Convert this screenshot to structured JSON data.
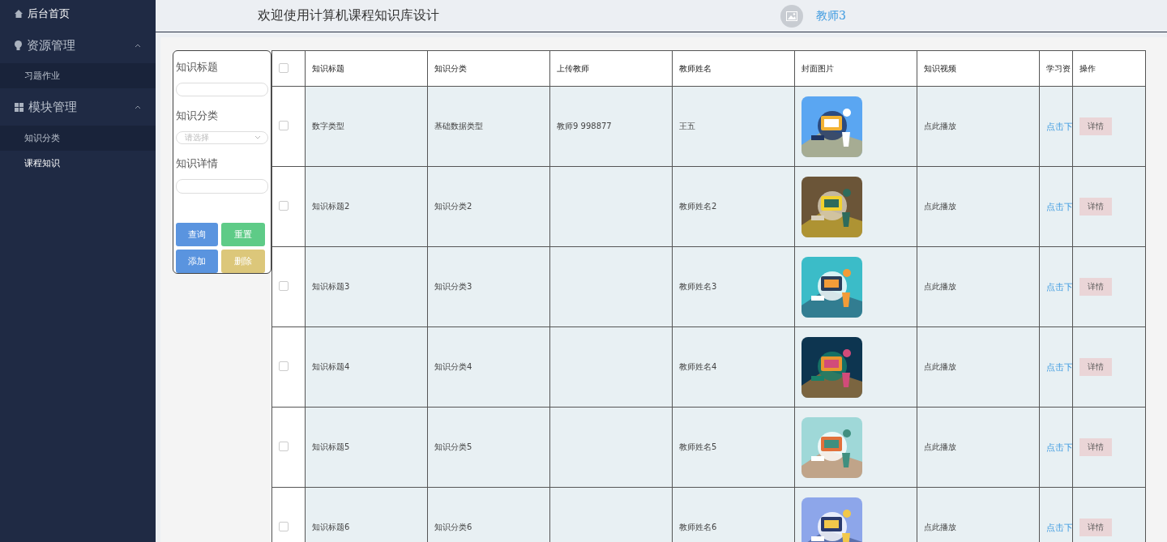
{
  "sidebar": {
    "items": [
      {
        "label": "后台首页"
      },
      {
        "label": "资源管理",
        "expanded": true,
        "children": [
          {
            "label": "习题作业",
            "selected": false
          }
        ]
      },
      {
        "label": "模块管理",
        "expanded": true,
        "children": [
          {
            "label": "知识分类",
            "selected": false
          },
          {
            "label": "课程知识",
            "selected": true
          }
        ]
      }
    ]
  },
  "header": {
    "title": "欢迎使用计算机课程知识库设计",
    "user": "教师3"
  },
  "search": {
    "fields": [
      {
        "label": "知识标题",
        "kind": "input"
      },
      {
        "label": "知识分类",
        "kind": "select",
        "placeholder": "请选择"
      },
      {
        "label": "知识详情",
        "kind": "input"
      }
    ],
    "buttons": [
      {
        "label": "查询",
        "color": "#5a94df"
      },
      {
        "label": "重置",
        "color": "#5ecb87"
      },
      {
        "label": "添加",
        "color": "#5a94df"
      },
      {
        "label": "删除",
        "color": "#dcc77a"
      }
    ]
  },
  "table": {
    "header_checked": false,
    "columns": [
      "知识标题",
      "知识分类",
      "上传教师",
      "教师姓名",
      "封面图片",
      "知识视频",
      "学习资",
      "操作"
    ],
    "rows": [
      {
        "checked": false,
        "title": "数字类型",
        "category": "基础数据类型",
        "teacher": "教师9 998877",
        "name": "王五",
        "video": "点此播放",
        "resource": "点击下",
        "action": "详情"
      },
      {
        "checked": false,
        "title": "知识标题2",
        "category": "知识分类2",
        "name": "教师姓名2",
        "video": "点此播放",
        "resource": "点击下",
        "action": "详情"
      },
      {
        "checked": false,
        "title": "知识标题3",
        "category": "知识分类3",
        "name": "教师姓名3",
        "video": "点此播放",
        "resource": "点击下",
        "action": "详情"
      },
      {
        "checked": false,
        "title": "知识标题4",
        "category": "知识分类4",
        "name": "教师姓名4",
        "video": "点此播放",
        "resource": "点击下",
        "action": "详情"
      },
      {
        "checked": false,
        "title": "知识标题5",
        "category": "知识分类5",
        "name": "教师姓名5",
        "video": "点此播放",
        "resource": "点击下",
        "action": "详情"
      },
      {
        "checked": false,
        "title": "知识标题6",
        "category": "知识分类6",
        "name": "教师姓名6",
        "video": "点此播放",
        "resource": "点击下",
        "action": "详情"
      }
    ]
  }
}
